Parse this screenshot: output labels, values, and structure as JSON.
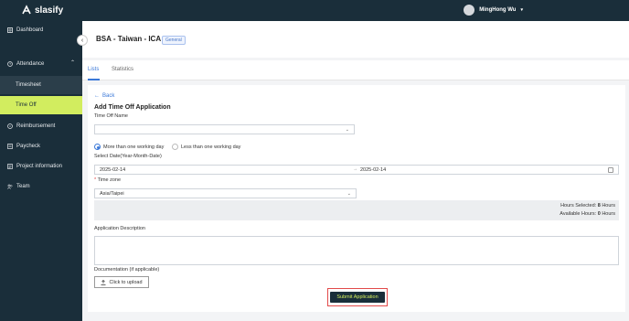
{
  "app": {
    "logo_text": "slasify"
  },
  "user": {
    "name": "MingHong Wu"
  },
  "sidebar": {
    "items": [
      {
        "label": "Dashboard",
        "icon": "dashboard-icon"
      },
      {
        "label": "Attendance",
        "icon": "clock-icon",
        "expanded": true,
        "children": [
          {
            "label": "Timesheet"
          },
          {
            "label": "Time Off",
            "active": true
          }
        ]
      },
      {
        "label": "Reimbursement",
        "icon": "receipt-icon"
      },
      {
        "label": "Paycheck",
        "icon": "paycheck-icon"
      },
      {
        "label": "Project information",
        "icon": "document-icon"
      },
      {
        "label": "Team",
        "icon": "team-icon"
      }
    ]
  },
  "page": {
    "title": "BSA - Taiwan - ICA",
    "badge": "General"
  },
  "tabs": [
    {
      "label": "Lists",
      "active": true
    },
    {
      "label": "Statistics"
    }
  ],
  "form": {
    "back_label": "Back",
    "title": "Add Time Off Application",
    "time_off_name_label": "Time Off Name",
    "time_off_name_value": "",
    "radio_options": [
      {
        "label": "More than one working day",
        "checked": true
      },
      {
        "label": "Less than one working day",
        "checked": false
      }
    ],
    "date_label": "Select Date(Year-Month-Date)",
    "date_start": "2025-02-14",
    "date_sep": "→",
    "date_end": "2025-02-14",
    "timezone_required_mark": "*",
    "timezone_label": "Time zone",
    "timezone_value": "Asia/Taipei",
    "hours_selected_label": "Hours Selected:",
    "hours_selected_value": "8",
    "hours_selected_unit": "Hours",
    "available_hours_label": "Available Hours:",
    "available_hours_value": "0",
    "available_hours_unit": "Hours",
    "description_label": "Application Description",
    "documentation_label": "Documentation (if applicable)",
    "upload_label": "Click to upload",
    "submit_label": "Submit Application"
  },
  "colors": {
    "sidebar_bg": "#1a2e3a",
    "accent": "#d2ed5f",
    "link": "#3a78d8",
    "highlight": "#e24a4a"
  }
}
